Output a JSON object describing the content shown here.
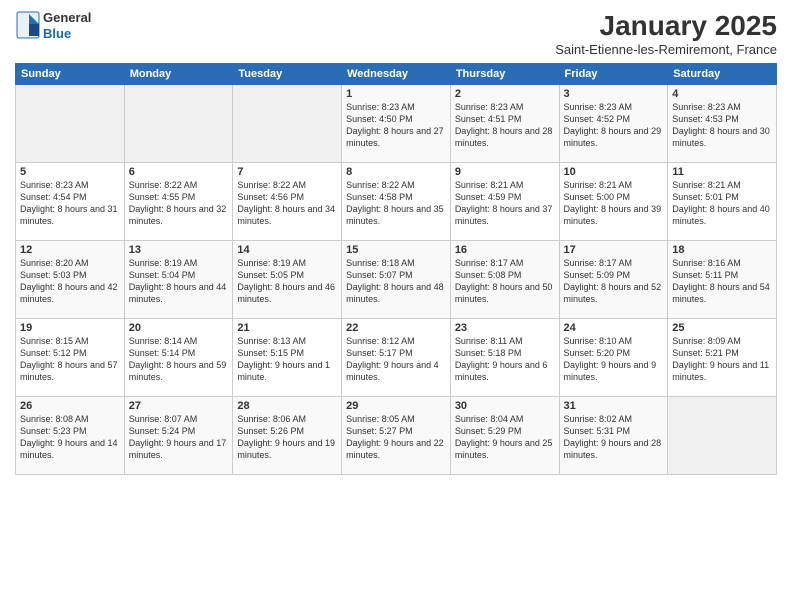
{
  "logo": {
    "general": "General",
    "blue": "Blue"
  },
  "header": {
    "month": "January 2025",
    "location": "Saint-Etienne-les-Remiremont, France"
  },
  "weekdays": [
    "Sunday",
    "Monday",
    "Tuesday",
    "Wednesday",
    "Thursday",
    "Friday",
    "Saturday"
  ],
  "weeks": [
    [
      {
        "day": "",
        "sunrise": "",
        "sunset": "",
        "daylight": ""
      },
      {
        "day": "",
        "sunrise": "",
        "sunset": "",
        "daylight": ""
      },
      {
        "day": "",
        "sunrise": "",
        "sunset": "",
        "daylight": ""
      },
      {
        "day": "1",
        "sunrise": "Sunrise: 8:23 AM",
        "sunset": "Sunset: 4:50 PM",
        "daylight": "Daylight: 8 hours and 27 minutes."
      },
      {
        "day": "2",
        "sunrise": "Sunrise: 8:23 AM",
        "sunset": "Sunset: 4:51 PM",
        "daylight": "Daylight: 8 hours and 28 minutes."
      },
      {
        "day": "3",
        "sunrise": "Sunrise: 8:23 AM",
        "sunset": "Sunset: 4:52 PM",
        "daylight": "Daylight: 8 hours and 29 minutes."
      },
      {
        "day": "4",
        "sunrise": "Sunrise: 8:23 AM",
        "sunset": "Sunset: 4:53 PM",
        "daylight": "Daylight: 8 hours and 30 minutes."
      }
    ],
    [
      {
        "day": "5",
        "sunrise": "Sunrise: 8:23 AM",
        "sunset": "Sunset: 4:54 PM",
        "daylight": "Daylight: 8 hours and 31 minutes."
      },
      {
        "day": "6",
        "sunrise": "Sunrise: 8:22 AM",
        "sunset": "Sunset: 4:55 PM",
        "daylight": "Daylight: 8 hours and 32 minutes."
      },
      {
        "day": "7",
        "sunrise": "Sunrise: 8:22 AM",
        "sunset": "Sunset: 4:56 PM",
        "daylight": "Daylight: 8 hours and 34 minutes."
      },
      {
        "day": "8",
        "sunrise": "Sunrise: 8:22 AM",
        "sunset": "Sunset: 4:58 PM",
        "daylight": "Daylight: 8 hours and 35 minutes."
      },
      {
        "day": "9",
        "sunrise": "Sunrise: 8:21 AM",
        "sunset": "Sunset: 4:59 PM",
        "daylight": "Daylight: 8 hours and 37 minutes."
      },
      {
        "day": "10",
        "sunrise": "Sunrise: 8:21 AM",
        "sunset": "Sunset: 5:00 PM",
        "daylight": "Daylight: 8 hours and 39 minutes."
      },
      {
        "day": "11",
        "sunrise": "Sunrise: 8:21 AM",
        "sunset": "Sunset: 5:01 PM",
        "daylight": "Daylight: 8 hours and 40 minutes."
      }
    ],
    [
      {
        "day": "12",
        "sunrise": "Sunrise: 8:20 AM",
        "sunset": "Sunset: 5:03 PM",
        "daylight": "Daylight: 8 hours and 42 minutes."
      },
      {
        "day": "13",
        "sunrise": "Sunrise: 8:19 AM",
        "sunset": "Sunset: 5:04 PM",
        "daylight": "Daylight: 8 hours and 44 minutes."
      },
      {
        "day": "14",
        "sunrise": "Sunrise: 8:19 AM",
        "sunset": "Sunset: 5:05 PM",
        "daylight": "Daylight: 8 hours and 46 minutes."
      },
      {
        "day": "15",
        "sunrise": "Sunrise: 8:18 AM",
        "sunset": "Sunset: 5:07 PM",
        "daylight": "Daylight: 8 hours and 48 minutes."
      },
      {
        "day": "16",
        "sunrise": "Sunrise: 8:17 AM",
        "sunset": "Sunset: 5:08 PM",
        "daylight": "Daylight: 8 hours and 50 minutes."
      },
      {
        "day": "17",
        "sunrise": "Sunrise: 8:17 AM",
        "sunset": "Sunset: 5:09 PM",
        "daylight": "Daylight: 8 hours and 52 minutes."
      },
      {
        "day": "18",
        "sunrise": "Sunrise: 8:16 AM",
        "sunset": "Sunset: 5:11 PM",
        "daylight": "Daylight: 8 hours and 54 minutes."
      }
    ],
    [
      {
        "day": "19",
        "sunrise": "Sunrise: 8:15 AM",
        "sunset": "Sunset: 5:12 PM",
        "daylight": "Daylight: 8 hours and 57 minutes."
      },
      {
        "day": "20",
        "sunrise": "Sunrise: 8:14 AM",
        "sunset": "Sunset: 5:14 PM",
        "daylight": "Daylight: 8 hours and 59 minutes."
      },
      {
        "day": "21",
        "sunrise": "Sunrise: 8:13 AM",
        "sunset": "Sunset: 5:15 PM",
        "daylight": "Daylight: 9 hours and 1 minute."
      },
      {
        "day": "22",
        "sunrise": "Sunrise: 8:12 AM",
        "sunset": "Sunset: 5:17 PM",
        "daylight": "Daylight: 9 hours and 4 minutes."
      },
      {
        "day": "23",
        "sunrise": "Sunrise: 8:11 AM",
        "sunset": "Sunset: 5:18 PM",
        "daylight": "Daylight: 9 hours and 6 minutes."
      },
      {
        "day": "24",
        "sunrise": "Sunrise: 8:10 AM",
        "sunset": "Sunset: 5:20 PM",
        "daylight": "Daylight: 9 hours and 9 minutes."
      },
      {
        "day": "25",
        "sunrise": "Sunrise: 8:09 AM",
        "sunset": "Sunset: 5:21 PM",
        "daylight": "Daylight: 9 hours and 11 minutes."
      }
    ],
    [
      {
        "day": "26",
        "sunrise": "Sunrise: 8:08 AM",
        "sunset": "Sunset: 5:23 PM",
        "daylight": "Daylight: 9 hours and 14 minutes."
      },
      {
        "day": "27",
        "sunrise": "Sunrise: 8:07 AM",
        "sunset": "Sunset: 5:24 PM",
        "daylight": "Daylight: 9 hours and 17 minutes."
      },
      {
        "day": "28",
        "sunrise": "Sunrise: 8:06 AM",
        "sunset": "Sunset: 5:26 PM",
        "daylight": "Daylight: 9 hours and 19 minutes."
      },
      {
        "day": "29",
        "sunrise": "Sunrise: 8:05 AM",
        "sunset": "Sunset: 5:27 PM",
        "daylight": "Daylight: 9 hours and 22 minutes."
      },
      {
        "day": "30",
        "sunrise": "Sunrise: 8:04 AM",
        "sunset": "Sunset: 5:29 PM",
        "daylight": "Daylight: 9 hours and 25 minutes."
      },
      {
        "day": "31",
        "sunrise": "Sunrise: 8:02 AM",
        "sunset": "Sunset: 5:31 PM",
        "daylight": "Daylight: 9 hours and 28 minutes."
      },
      {
        "day": "",
        "sunrise": "",
        "sunset": "",
        "daylight": ""
      }
    ]
  ]
}
